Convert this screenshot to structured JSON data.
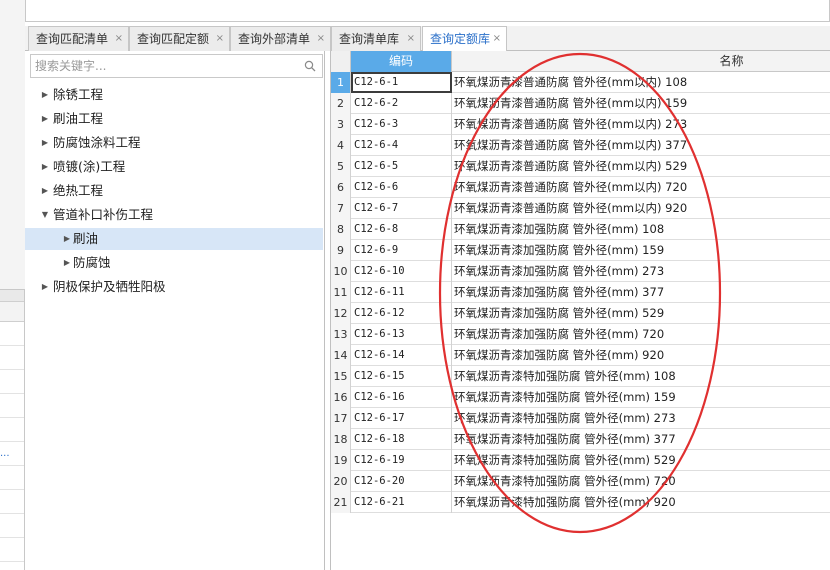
{
  "tabs": [
    {
      "label": "查询匹配清单",
      "active": false
    },
    {
      "label": "查询匹配定额",
      "active": false
    },
    {
      "label": "查询外部清单",
      "active": false
    },
    {
      "label": "查询清单库",
      "active": false
    },
    {
      "label": "查询定额库",
      "active": true
    }
  ],
  "tab_close_glyph": "×",
  "search": {
    "placeholder": "搜索关键字...",
    "value": "",
    "icon": "search-icon"
  },
  "tree": {
    "items": [
      {
        "label": "除锈工程",
        "expanded": false,
        "level": 0
      },
      {
        "label": "刷油工程",
        "expanded": false,
        "level": 0
      },
      {
        "label": "防腐蚀涂料工程",
        "expanded": false,
        "level": 0
      },
      {
        "label": "喷镀(涂)工程",
        "expanded": false,
        "level": 0
      },
      {
        "label": "绝热工程",
        "expanded": false,
        "level": 0
      },
      {
        "label": "管道补口补伤工程",
        "expanded": true,
        "level": 0
      },
      {
        "label": "刷油",
        "expanded": false,
        "level": 1,
        "selected": true
      },
      {
        "label": "防腐蚀",
        "expanded": false,
        "level": 1
      },
      {
        "label": "阴极保护及牺牲阳极",
        "expanded": false,
        "level": 0
      }
    ],
    "collapsed_glyph": "▶",
    "expanded_glyph": "▼"
  },
  "table": {
    "columns": {
      "code": "编码",
      "name": "名称"
    },
    "rows": [
      {
        "num": "1",
        "code": "C12-6-1",
        "name": "环氧煤沥青漆普通防腐 管外径(mm以内) 108"
      },
      {
        "num": "2",
        "code": "C12-6-2",
        "name": "环氧煤沥青漆普通防腐 管外径(mm以内) 159"
      },
      {
        "num": "3",
        "code": "C12-6-3",
        "name": "环氧煤沥青漆普通防腐 管外径(mm以内) 273"
      },
      {
        "num": "4",
        "code": "C12-6-4",
        "name": "环氧煤沥青漆普通防腐 管外径(mm以内) 377"
      },
      {
        "num": "5",
        "code": "C12-6-5",
        "name": "环氧煤沥青漆普通防腐 管外径(mm以内) 529"
      },
      {
        "num": "6",
        "code": "C12-6-6",
        "name": "环氧煤沥青漆普通防腐 管外径(mm以内) 720"
      },
      {
        "num": "7",
        "code": "C12-6-7",
        "name": "环氧煤沥青漆普通防腐 管外径(mm以内) 920"
      },
      {
        "num": "8",
        "code": "C12-6-8",
        "name": "环氧煤沥青漆加强防腐 管外径(mm) 108"
      },
      {
        "num": "9",
        "code": "C12-6-9",
        "name": "环氧煤沥青漆加强防腐 管外径(mm) 159"
      },
      {
        "num": "10",
        "code": "C12-6-10",
        "name": "环氧煤沥青漆加强防腐 管外径(mm) 273"
      },
      {
        "num": "11",
        "code": "C12-6-11",
        "name": "环氧煤沥青漆加强防腐 管外径(mm) 377"
      },
      {
        "num": "12",
        "code": "C12-6-12",
        "name": "环氧煤沥青漆加强防腐 管外径(mm) 529"
      },
      {
        "num": "13",
        "code": "C12-6-13",
        "name": "环氧煤沥青漆加强防腐 管外径(mm) 720"
      },
      {
        "num": "14",
        "code": "C12-6-14",
        "name": "环氧煤沥青漆加强防腐 管外径(mm) 920"
      },
      {
        "num": "15",
        "code": "C12-6-15",
        "name": "环氧煤沥青漆特加强防腐 管外径(mm) 108"
      },
      {
        "num": "16",
        "code": "C12-6-16",
        "name": "环氧煤沥青漆特加强防腐 管外径(mm) 159"
      },
      {
        "num": "17",
        "code": "C12-6-17",
        "name": "环氧煤沥青漆特加强防腐 管外径(mm) 273"
      },
      {
        "num": "18",
        "code": "C12-6-18",
        "name": "环氧煤沥青漆特加强防腐 管外径(mm) 377"
      },
      {
        "num": "19",
        "code": "C12-6-19",
        "name": "环氧煤沥青漆特加强防腐 管外径(mm) 529"
      },
      {
        "num": "20",
        "code": "C12-6-20",
        "name": "环氧煤沥青漆特加强防腐 管外径(mm) 720"
      },
      {
        "num": "21",
        "code": "C12-6-21",
        "name": "环氧煤沥青漆特加强防腐 管外径(mm) 920"
      }
    ],
    "selected_row": "1"
  },
  "left_strip": {
    "fragments": [
      "..."
    ]
  },
  "colors": {
    "accent": "#5aaae8",
    "annotation": "#e03030",
    "tab_active_text": "#2a6fc9",
    "tree_selected": "#d7e6f7"
  }
}
